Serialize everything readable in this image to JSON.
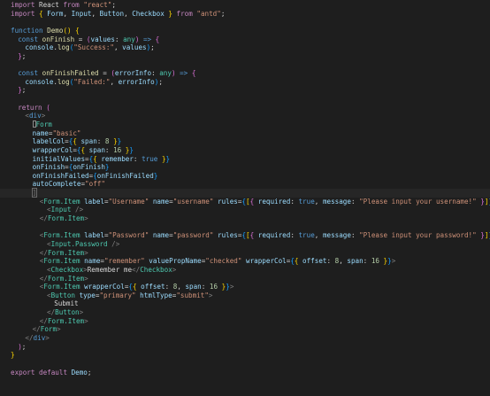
{
  "theme": {
    "background": "#1e1e1e",
    "colors": {
      "kw": "#c586c0",
      "st": "#569cd6",
      "fn": "#dcdcaa",
      "va": "#9cdcfe",
      "ty": "#4ec9b0",
      "s": "#ce9178",
      "tg": "#569cd6",
      "tc": "#4ec9b0",
      "at": "#9cdcfe",
      "pu": "#d4d4d4",
      "br": "#ffd700",
      "br2": "#da70d6",
      "br3": "#179fff",
      "ag": "#808080",
      "nu": "#b5cea8",
      "op": "#d4d4d4"
    }
  },
  "editor": {
    "language": "tsx",
    "lines": [
      {
        "indent": 0,
        "tokens": [
          [
            "kw",
            "import"
          ],
          [
            "pu",
            " React "
          ],
          [
            "kw",
            "from"
          ],
          [
            "s",
            " \"react\""
          ],
          [
            "pu",
            ";"
          ]
        ]
      },
      {
        "indent": 0,
        "tokens": [
          [
            "kw",
            "import"
          ],
          [
            "br",
            " { "
          ],
          [
            "va",
            "Form"
          ],
          [
            "pu",
            ", "
          ],
          [
            "va",
            "Input"
          ],
          [
            "pu",
            ", "
          ],
          [
            "va",
            "Button"
          ],
          [
            "pu",
            ", "
          ],
          [
            "va",
            "Checkbox"
          ],
          [
            "br",
            " }"
          ],
          [
            "kw",
            " from"
          ],
          [
            "s",
            " \"antd\""
          ],
          [
            "pu",
            ";"
          ]
        ]
      },
      {
        "indent": 0,
        "tokens": []
      },
      {
        "indent": 0,
        "tokens": [
          [
            "st",
            "function"
          ],
          [
            "fn",
            " Demo"
          ],
          [
            "br",
            "()"
          ],
          [
            "br",
            " {"
          ]
        ]
      },
      {
        "indent": 1,
        "tokens": [
          [
            "st",
            "const"
          ],
          [
            "fn",
            " onFinish"
          ],
          [
            "op",
            " = "
          ],
          [
            "br2",
            "("
          ],
          [
            "va",
            "values"
          ],
          [
            "pu",
            ": "
          ],
          [
            "ty",
            "any"
          ],
          [
            "br2",
            ")"
          ],
          [
            "st",
            " =>"
          ],
          [
            "br2",
            " {"
          ]
        ]
      },
      {
        "indent": 2,
        "tokens": [
          [
            "va",
            "console"
          ],
          [
            "pu",
            "."
          ],
          [
            "fn",
            "log"
          ],
          [
            "br3",
            "("
          ],
          [
            "s",
            "\"Success:\""
          ],
          [
            "pu",
            ", "
          ],
          [
            "va",
            "values"
          ],
          [
            "br3",
            ")"
          ],
          [
            "pu",
            ";"
          ]
        ]
      },
      {
        "indent": 1,
        "tokens": [
          [
            "br2",
            "}"
          ],
          [
            "pu",
            ";"
          ]
        ]
      },
      {
        "indent": 0,
        "tokens": []
      },
      {
        "indent": 1,
        "tokens": [
          [
            "st",
            "const"
          ],
          [
            "fn",
            " onFinishFailed"
          ],
          [
            "op",
            " = "
          ],
          [
            "br2",
            "("
          ],
          [
            "va",
            "errorInfo"
          ],
          [
            "pu",
            ": "
          ],
          [
            "ty",
            "any"
          ],
          [
            "br2",
            ")"
          ],
          [
            "st",
            " =>"
          ],
          [
            "br2",
            " {"
          ]
        ]
      },
      {
        "indent": 2,
        "tokens": [
          [
            "va",
            "console"
          ],
          [
            "pu",
            "."
          ],
          [
            "fn",
            "log"
          ],
          [
            "br3",
            "("
          ],
          [
            "s",
            "\"Failed:\""
          ],
          [
            "pu",
            ", "
          ],
          [
            "va",
            "errorInfo"
          ],
          [
            "br3",
            ")"
          ],
          [
            "pu",
            ";"
          ]
        ]
      },
      {
        "indent": 1,
        "tokens": [
          [
            "br2",
            "}"
          ],
          [
            "pu",
            ";"
          ]
        ]
      },
      {
        "indent": 0,
        "tokens": []
      },
      {
        "indent": 1,
        "tokens": [
          [
            "kw",
            "return"
          ],
          [
            "br2",
            " ("
          ]
        ]
      },
      {
        "indent": 2,
        "tokens": [
          [
            "ag",
            "<"
          ],
          [
            "tg",
            "div"
          ],
          [
            "ag",
            ">"
          ]
        ]
      },
      {
        "indent": 3,
        "cursor_before": true,
        "tokens": [
          [
            "tc",
            "Form"
          ]
        ]
      },
      {
        "indent": 3,
        "tokens": [
          [
            "at",
            "name"
          ],
          [
            "op",
            "="
          ],
          [
            "s",
            "\"basic\""
          ]
        ]
      },
      {
        "indent": 3,
        "tokens": [
          [
            "at",
            "labelCol"
          ],
          [
            "op",
            "="
          ],
          [
            "br3",
            "{"
          ],
          [
            "br",
            "{"
          ],
          [
            "va",
            " span"
          ],
          [
            "pu",
            ": "
          ],
          [
            "nu",
            "8"
          ],
          [
            "br",
            " }"
          ],
          [
            "br3",
            "}"
          ]
        ]
      },
      {
        "indent": 3,
        "tokens": [
          [
            "at",
            "wrapperCol"
          ],
          [
            "op",
            "="
          ],
          [
            "br3",
            "{"
          ],
          [
            "br",
            "{"
          ],
          [
            "va",
            " span"
          ],
          [
            "pu",
            ": "
          ],
          [
            "nu",
            "16"
          ],
          [
            "br",
            " }"
          ],
          [
            "br3",
            "}"
          ]
        ]
      },
      {
        "indent": 3,
        "tokens": [
          [
            "at",
            "initialValues"
          ],
          [
            "op",
            "="
          ],
          [
            "br3",
            "{"
          ],
          [
            "br",
            "{"
          ],
          [
            "va",
            " remember"
          ],
          [
            "pu",
            ": "
          ],
          [
            "st",
            "true"
          ],
          [
            "br",
            " }"
          ],
          [
            "br3",
            "}"
          ]
        ]
      },
      {
        "indent": 3,
        "tokens": [
          [
            "at",
            "onFinish"
          ],
          [
            "op",
            "="
          ],
          [
            "br3",
            "{"
          ],
          [
            "va",
            "onFinish"
          ],
          [
            "br3",
            "}"
          ]
        ]
      },
      {
        "indent": 3,
        "tokens": [
          [
            "at",
            "onFinishFailed"
          ],
          [
            "op",
            "="
          ],
          [
            "br3",
            "{"
          ],
          [
            "va",
            "onFinishFailed"
          ],
          [
            "br3",
            "}"
          ]
        ]
      },
      {
        "indent": 3,
        "tokens": [
          [
            "at",
            "autoComplete"
          ],
          [
            "op",
            "="
          ],
          [
            "s",
            "\"off\""
          ]
        ]
      },
      {
        "indent": 3,
        "bracket_line": true,
        "tokens": [
          [
            "ag",
            "]"
          ]
        ]
      },
      {
        "indent": 4,
        "tokens": [
          [
            "ag",
            "<"
          ],
          [
            "tc",
            "Form.Item"
          ],
          [
            "at",
            " label"
          ],
          [
            "op",
            "="
          ],
          [
            "s",
            "\"Username\""
          ],
          [
            "at",
            " name"
          ],
          [
            "op",
            "="
          ],
          [
            "s",
            "\"username\""
          ],
          [
            "at",
            " rules"
          ],
          [
            "op",
            "="
          ],
          [
            "br3",
            "{"
          ],
          [
            "br",
            "["
          ],
          [
            "br2",
            "{"
          ],
          [
            "va",
            " required"
          ],
          [
            "pu",
            ": "
          ],
          [
            "st",
            "true"
          ],
          [
            "pu",
            ", "
          ],
          [
            "va",
            "message"
          ],
          [
            "pu",
            ": "
          ],
          [
            "s",
            "\"Please input your username!\""
          ],
          [
            "br2",
            " }"
          ],
          [
            "br",
            "]"
          ],
          [
            "br3",
            "}"
          ],
          [
            "ag",
            ">"
          ]
        ]
      },
      {
        "indent": 5,
        "tokens": [
          [
            "ag",
            "<"
          ],
          [
            "tc",
            "Input"
          ],
          [
            "ag",
            " />"
          ]
        ]
      },
      {
        "indent": 4,
        "tokens": [
          [
            "ag",
            "</"
          ],
          [
            "tc",
            "Form.Item"
          ],
          [
            "ag",
            ">"
          ]
        ]
      },
      {
        "indent": 0,
        "tokens": []
      },
      {
        "indent": 4,
        "tokens": [
          [
            "ag",
            "<"
          ],
          [
            "tc",
            "Form.Item"
          ],
          [
            "at",
            " label"
          ],
          [
            "op",
            "="
          ],
          [
            "s",
            "\"Password\""
          ],
          [
            "at",
            " name"
          ],
          [
            "op",
            "="
          ],
          [
            "s",
            "\"password\""
          ],
          [
            "at",
            " rules"
          ],
          [
            "op",
            "="
          ],
          [
            "br3",
            "{"
          ],
          [
            "br",
            "["
          ],
          [
            "br2",
            "{"
          ],
          [
            "va",
            " required"
          ],
          [
            "pu",
            ": "
          ],
          [
            "st",
            "true"
          ],
          [
            "pu",
            ", "
          ],
          [
            "va",
            "message"
          ],
          [
            "pu",
            ": "
          ],
          [
            "s",
            "\"Please input your password!\""
          ],
          [
            "br2",
            " }"
          ],
          [
            "br",
            "]"
          ],
          [
            "br3",
            "}"
          ],
          [
            "ag",
            ">"
          ]
        ]
      },
      {
        "indent": 5,
        "tokens": [
          [
            "ag",
            "<"
          ],
          [
            "tc",
            "Input.Password"
          ],
          [
            "ag",
            " />"
          ]
        ]
      },
      {
        "indent": 4,
        "tokens": [
          [
            "ag",
            "</"
          ],
          [
            "tc",
            "Form.Item"
          ],
          [
            "ag",
            ">"
          ]
        ]
      },
      {
        "indent": 4,
        "tokens": [
          [
            "ag",
            "<"
          ],
          [
            "tc",
            "Form.Item"
          ],
          [
            "at",
            " name"
          ],
          [
            "op",
            "="
          ],
          [
            "s",
            "\"remember\""
          ],
          [
            "at",
            " valuePropName"
          ],
          [
            "op",
            "="
          ],
          [
            "s",
            "\"checked\""
          ],
          [
            "at",
            " wrapperCol"
          ],
          [
            "op",
            "="
          ],
          [
            "br3",
            "{"
          ],
          [
            "br",
            "{"
          ],
          [
            "va",
            " offset"
          ],
          [
            "pu",
            ": "
          ],
          [
            "nu",
            "8"
          ],
          [
            "pu",
            ", "
          ],
          [
            "va",
            "span"
          ],
          [
            "pu",
            ": "
          ],
          [
            "nu",
            "16"
          ],
          [
            "br",
            " }"
          ],
          [
            "br3",
            "}"
          ],
          [
            "ag",
            ">"
          ]
        ]
      },
      {
        "indent": 5,
        "tokens": [
          [
            "ag",
            "<"
          ],
          [
            "tc",
            "Checkbox"
          ],
          [
            "ag",
            ">"
          ],
          [
            "pu",
            "Remember me"
          ],
          [
            "ag",
            "</"
          ],
          [
            "tc",
            "Checkbox"
          ],
          [
            "ag",
            ">"
          ]
        ]
      },
      {
        "indent": 4,
        "tokens": [
          [
            "ag",
            "</"
          ],
          [
            "tc",
            "Form.Item"
          ],
          [
            "ag",
            ">"
          ]
        ]
      },
      {
        "indent": 4,
        "tokens": [
          [
            "ag",
            "<"
          ],
          [
            "tc",
            "Form.Item"
          ],
          [
            "at",
            " wrapperCol"
          ],
          [
            "op",
            "="
          ],
          [
            "br3",
            "{"
          ],
          [
            "br",
            "{"
          ],
          [
            "va",
            " offset"
          ],
          [
            "pu",
            ": "
          ],
          [
            "nu",
            "8"
          ],
          [
            "pu",
            ", "
          ],
          [
            "va",
            "span"
          ],
          [
            "pu",
            ": "
          ],
          [
            "nu",
            "16"
          ],
          [
            "br",
            " }"
          ],
          [
            "br3",
            "}"
          ],
          [
            "ag",
            ">"
          ]
        ]
      },
      {
        "indent": 5,
        "tokens": [
          [
            "ag",
            "<"
          ],
          [
            "tc",
            "Button"
          ],
          [
            "at",
            " type"
          ],
          [
            "op",
            "="
          ],
          [
            "s",
            "\"primary\""
          ],
          [
            "at",
            " htmlType"
          ],
          [
            "op",
            "="
          ],
          [
            "s",
            "\"submit\""
          ],
          [
            "ag",
            ">"
          ]
        ]
      },
      {
        "indent": 6,
        "tokens": [
          [
            "pu",
            "Submit"
          ]
        ]
      },
      {
        "indent": 5,
        "tokens": [
          [
            "ag",
            "</"
          ],
          [
            "tc",
            "Button"
          ],
          [
            "ag",
            ">"
          ]
        ]
      },
      {
        "indent": 4,
        "tokens": [
          [
            "ag",
            "</"
          ],
          [
            "tc",
            "Form.Item"
          ],
          [
            "ag",
            ">"
          ]
        ]
      },
      {
        "indent": 3,
        "tokens": [
          [
            "ag",
            "</"
          ],
          [
            "tc",
            "Form"
          ],
          [
            "ag",
            ">"
          ]
        ]
      },
      {
        "indent": 2,
        "tokens": [
          [
            "ag",
            "</"
          ],
          [
            "tg",
            "div"
          ],
          [
            "ag",
            ">"
          ]
        ]
      },
      {
        "indent": 1,
        "tokens": [
          [
            "br2",
            ")"
          ],
          [
            "pu",
            ";"
          ]
        ]
      },
      {
        "indent": 0,
        "tokens": [
          [
            "br",
            "}"
          ]
        ]
      },
      {
        "indent": 0,
        "tokens": []
      },
      {
        "indent": 0,
        "tokens": [
          [
            "kw",
            "export"
          ],
          [
            "kw",
            " default"
          ],
          [
            "va",
            " Demo"
          ],
          [
            "pu",
            ";"
          ]
        ]
      }
    ]
  }
}
